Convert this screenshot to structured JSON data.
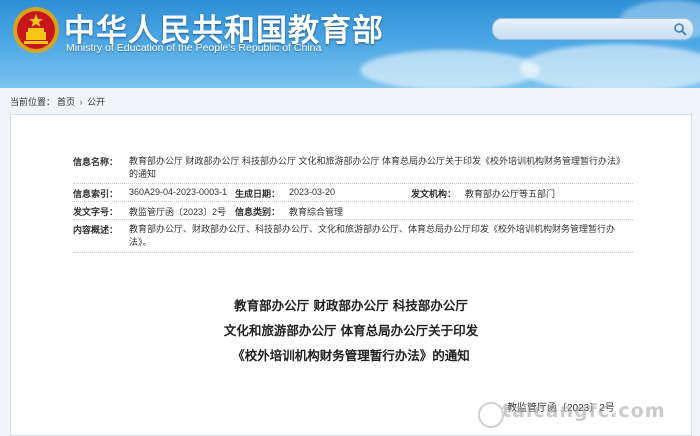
{
  "header": {
    "title": "中华人民共和国教育部",
    "subtitle": "Ministry of Education of the People's Republic of China",
    "search": {
      "placeholder": ""
    }
  },
  "breadcrumb": {
    "prefix": "当前位置：",
    "items": [
      "首页",
      "公开"
    ],
    "separator": "›"
  },
  "metadata": {
    "info_name": {
      "label": "信息名称：",
      "value": "教育部办公厅 财政部办公厅 科技部办公厅 文化和旅游部办公厅 体育总局办公厅关于印发《校外培训机构财务管理暂行办法》的通知"
    },
    "index": {
      "label": "信息索引：",
      "value": "360A29-04-2023-0003-1"
    },
    "date": {
      "label": "生成日期：",
      "value": "2023-03-20"
    },
    "issuer": {
      "label": "发文机构：",
      "value": "教育部办公厅等五部门"
    },
    "doc_code": {
      "label": "发文字号：",
      "value": "教监管厅函〔2023〕2号"
    },
    "category": {
      "label": "信息类别：",
      "value": "教育综合管理"
    },
    "summary": {
      "label": "内容概述：",
      "value": "教育部办公厅、财政部办公厅、科技部办公厅、文化和旅游部办公厅、体育总局办公厅印发《校外培训机构财务管理暂行办法》。"
    }
  },
  "document": {
    "title_lines": [
      "教育部办公厅 财政部办公厅 科技部办公厅",
      "文化和旅游部办公厅 体育总局办公厅关于印发",
      "《校外培训机构财务管理暂行办法》的通知"
    ],
    "number": "教监管厅函〔2023〕2号"
  },
  "watermark": {
    "text": "taicangfc.com"
  },
  "colors": {
    "header_blue": "#2f8fd6",
    "text": "#333333"
  }
}
